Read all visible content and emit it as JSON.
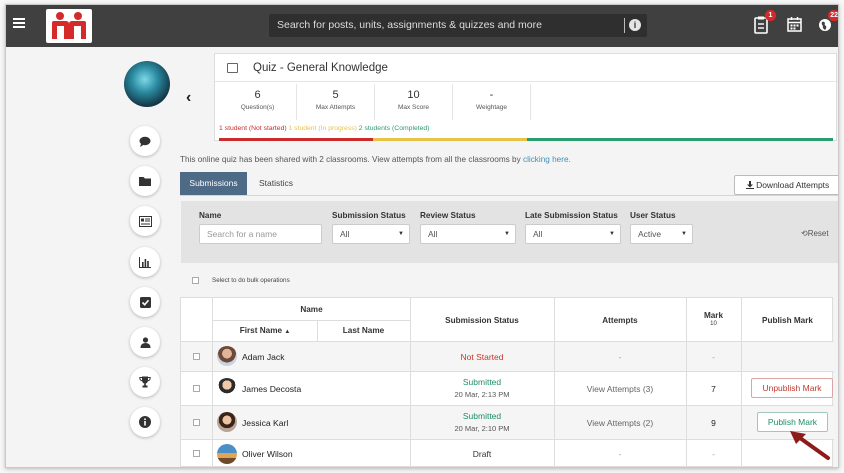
{
  "header": {
    "search_placeholder": "Search for posts, units, assignments & quizzes and more",
    "notifications_badge": "1",
    "profile_badge": "22"
  },
  "quiz": {
    "title": "Quiz - General Knowledge",
    "stats": [
      {
        "value": "6",
        "label": "Question(s)"
      },
      {
        "value": "5",
        "label": "Max Attempts"
      },
      {
        "value": "10",
        "label": "Max Score"
      },
      {
        "value": "-",
        "label": "Weightage"
      }
    ],
    "progress": {
      "not_started": "1 student (Not started)",
      "in_progress": "1 student (In progress)",
      "completed": "2 students (Completed)"
    },
    "colors": {
      "not_started": "#cc2b2b",
      "in_progress": "#e8c34a",
      "completed": "#2a9d6e"
    }
  },
  "shared": {
    "text": "This online quiz has been shared with 2 classrooms. View attempts from all the classrooms by",
    "link": "clicking here."
  },
  "tabs": {
    "submissions": "Submissions",
    "statistics": "Statistics"
  },
  "download_label": "Download Attempts",
  "filters": {
    "name_label": "Name",
    "name_placeholder": "Search for a name",
    "submission_status_label": "Submission Status",
    "submission_status_value": "All",
    "review_status_label": "Review Status",
    "review_status_value": "All",
    "late_submission_label": "Late Submission Status",
    "late_submission_value": "All",
    "user_status_label": "User Status",
    "user_status_value": "Active",
    "reset_label": "Reset"
  },
  "bulk_label": "Select to do bulk operations",
  "table": {
    "headers": {
      "name": "Name",
      "first_name": "First Name",
      "last_name": "Last Name",
      "submission_status": "Submission Status",
      "attempts": "Attempts",
      "mark": "Mark",
      "mark_max": "10",
      "publish_mark": "Publish Mark"
    },
    "rows": [
      {
        "name": "Adam Jack",
        "status": "Not Started",
        "date": "",
        "attempts": "-",
        "mark": "-",
        "action": ""
      },
      {
        "name": "James Decosta",
        "status": "Submitted",
        "date": "20 Mar, 2:13 PM",
        "attempts": "View Attempts (3)",
        "mark": "7",
        "action": "Unpublish Mark"
      },
      {
        "name": "Jessica Karl",
        "status": "Submitted",
        "date": "20 Mar, 2:10 PM",
        "attempts": "View Attempts (2)",
        "mark": "9",
        "action": "Publish Mark"
      },
      {
        "name": "Oliver Wilson",
        "status": "Draft",
        "date": "",
        "attempts": "-",
        "mark": "-",
        "action": ""
      }
    ]
  }
}
